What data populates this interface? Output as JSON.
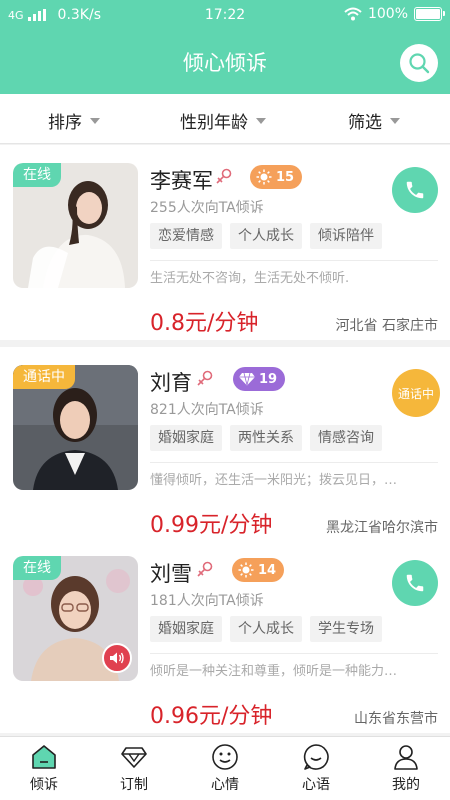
{
  "status_bar": {
    "network": "4G",
    "speed": "0.3K/s",
    "time": "17:22",
    "battery": "100%"
  },
  "header": {
    "title": "倾心倾诉",
    "search_icon": "search-icon"
  },
  "filters": [
    {
      "label": "排序"
    },
    {
      "label": "性别年龄"
    },
    {
      "label": "筛选"
    }
  ],
  "listeners": [
    {
      "status": "在线",
      "status_color": "#5fd6b0",
      "name": "李赛军",
      "gender": "female",
      "level_icon": "sun-icon",
      "level": "15",
      "level_color": "#f5a05a",
      "confide_count": "255人次向TA倾诉",
      "tags": [
        "恋爱情感",
        "个人成长",
        "倾诉陪伴"
      ],
      "intro": "生活无处不咨询，生活无处不倾听.",
      "price": "0.8元/分钟",
      "location": "河北省 石家庄市",
      "action": "call",
      "action_icon": "phone-icon"
    },
    {
      "status": "通话中",
      "status_color": "#f5b73b",
      "name": "刘育",
      "gender": "female",
      "level_icon": "diamond-icon",
      "level": "19",
      "level_color": "#9b6bd8",
      "confide_count": "821人次向TA倾诉",
      "tags": [
        "婚姻家庭",
        "两性关系",
        "情感咨询"
      ],
      "intro": "懂得倾听，还生活一米阳光；拨云见日，…",
      "price": "0.99元/分钟",
      "location": "黑龙江省哈尔滨市",
      "action": "calling",
      "action_label": "通话中"
    },
    {
      "status": "在线",
      "status_color": "#5fd6b0",
      "name": "刘雪",
      "gender": "female",
      "level_icon": "sun-icon",
      "level": "14",
      "level_color": "#f5a05a",
      "confide_count": "181人次向TA倾诉",
      "tags": [
        "婚姻家庭",
        "个人成长",
        "学生专场"
      ],
      "intro": "倾听是一种关注和尊重，倾听是一种能力…",
      "price": "0.96元/分钟",
      "location": "山东省东营市",
      "action": "call",
      "action_icon": "phone-icon",
      "has_voice": true,
      "voice_icon": "speaker-icon"
    }
  ],
  "tabbar": [
    {
      "label": "倾诉",
      "icon": "home-icon",
      "active": true
    },
    {
      "label": "订制",
      "icon": "diamond-icon"
    },
    {
      "label": "心情",
      "icon": "smile-icon"
    },
    {
      "label": "心语",
      "icon": "chat-smile-icon"
    },
    {
      "label": "我的",
      "icon": "user-icon"
    }
  ],
  "colors": {
    "accent": "#5fd6b0",
    "price": "#d8232a",
    "busy": "#f5b73b"
  }
}
